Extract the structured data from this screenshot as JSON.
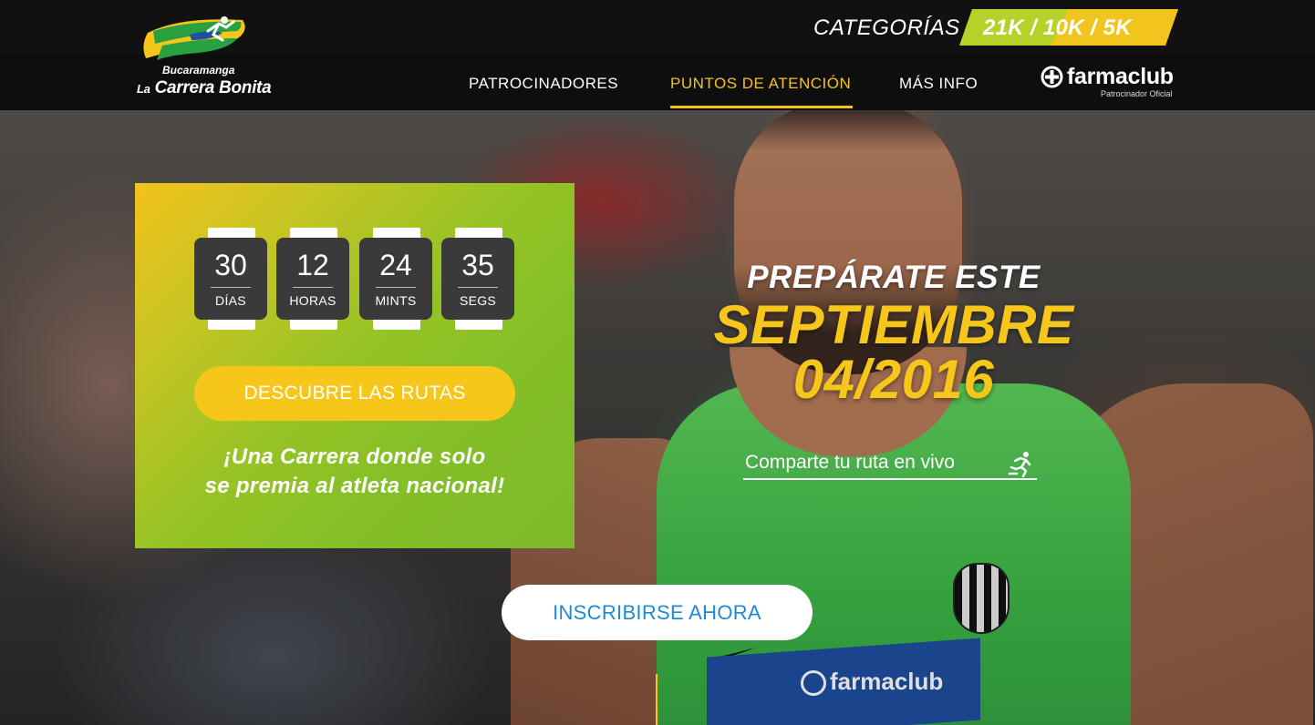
{
  "header": {
    "logo": {
      "line1": "Bucaramanga",
      "line2_prefix": "La",
      "line2": "Carrera Bonita"
    },
    "categories_label": "CATEGORÍAS",
    "categories_value": "21K  /  10K  /  5K",
    "nav": [
      {
        "label": "PATROCINADORES"
      },
      {
        "label": "PUNTOS DE  ATENCIÓN",
        "active": true
      },
      {
        "label": "MÁS INFO"
      }
    ],
    "sponsor": {
      "name": "farmaclub",
      "subtitle": "Patrocinador Oficial"
    }
  },
  "countdown": {
    "units": [
      {
        "value": "30",
        "label": "DÍAS"
      },
      {
        "value": "12",
        "label": "HORAS"
      },
      {
        "value": "24",
        "label": "MINTS"
      },
      {
        "value": "35",
        "label": "SEGS"
      }
    ],
    "button_label": "DESCUBRE LAS RUTAS",
    "tagline_line1": "¡Una Carrera donde solo",
    "tagline_line2": "se premia al atleta nacional!"
  },
  "hero": {
    "line1": "PREPÁRATE ESTE",
    "line2": "SEPTIEMBRE",
    "line3": "04/2016",
    "share_label": "Comparte tu ruta en vivo",
    "cta_label": "INSCRIBIRSE AHORA",
    "bib_text": "farmaclub"
  },
  "colors": {
    "accent_yellow": "#f6c61a",
    "header_bg": "#0e0e0e",
    "panel_green": "#84bf28",
    "cta_blue": "#1e8ad2"
  }
}
